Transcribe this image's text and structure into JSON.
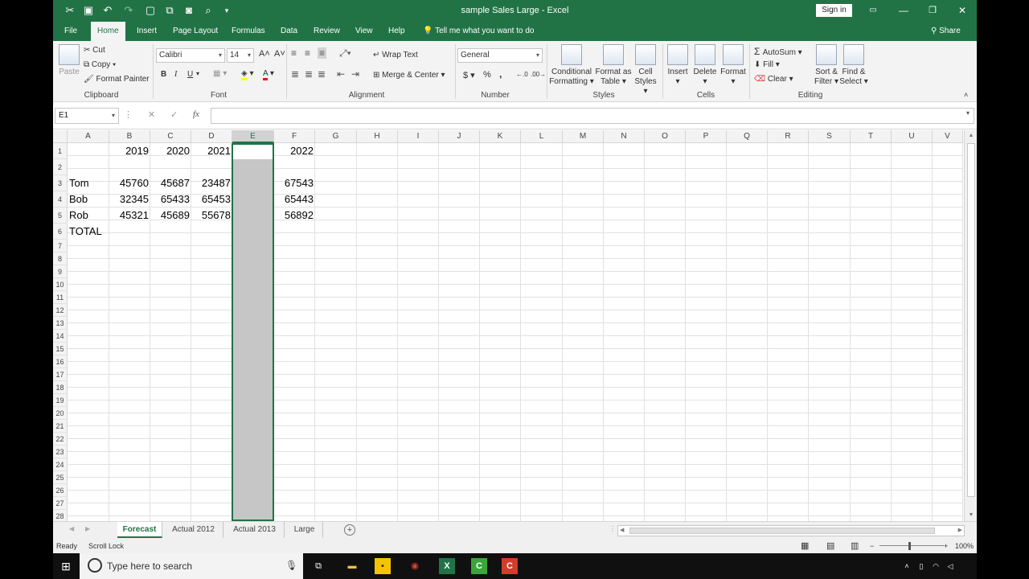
{
  "window": {
    "title": "sample Sales Large  -  Excel",
    "sign_in": "Sign in"
  },
  "tabs": [
    "File",
    "Home",
    "Insert",
    "Page Layout",
    "Formulas",
    "Data",
    "Review",
    "View",
    "Help"
  ],
  "active_tab": "Home",
  "tell_me": "Tell me what you want to do",
  "share": "Share",
  "ribbon": {
    "clipboard": {
      "paste": "Paste",
      "cut": "Cut",
      "copy": "Copy",
      "format_painter": "Format Painter",
      "label": "Clipboard"
    },
    "font": {
      "name": "Calibri",
      "size": "14",
      "bold": "B",
      "italic": "I",
      "underline": "U",
      "label": "Font"
    },
    "alignment": {
      "wrap": "Wrap Text",
      "merge": "Merge & Center",
      "label": "Alignment"
    },
    "number": {
      "format": "General",
      "currency": "$",
      "percent": "%",
      "comma": ",",
      "label": "Number"
    },
    "styles": {
      "conditional": [
        "Conditional",
        "Formatting"
      ],
      "format_table": [
        "Format as",
        "Table"
      ],
      "cell_styles": [
        "Cell",
        "Styles"
      ],
      "label": "Styles"
    },
    "cells": {
      "insert": "Insert",
      "delete": "Delete",
      "format": "Format",
      "label": "Cells"
    },
    "editing": {
      "autosum": "AutoSum",
      "fill": "Fill",
      "clear": "Clear",
      "sort": [
        "Sort &",
        "Filter"
      ],
      "find": [
        "Find &",
        "Select"
      ],
      "label": "Editing"
    }
  },
  "name_box": "E1",
  "formula_bar": {
    "fx": "fx",
    "cancel": "✕",
    "enter": "✓"
  },
  "columns": [
    "A",
    "B",
    "C",
    "D",
    "E",
    "F",
    "G",
    "H",
    "I",
    "J",
    "K",
    "L",
    "M",
    "N",
    "O",
    "P",
    "Q",
    "R",
    "S",
    "T",
    "U",
    "V"
  ],
  "rows": [
    "1",
    "2",
    "3",
    "4",
    "5",
    "6",
    "7",
    "8",
    "9",
    "10",
    "11",
    "12",
    "13",
    "14",
    "15",
    "16",
    "17",
    "18",
    "19",
    "20",
    "21",
    "22",
    "23",
    "24",
    "25",
    "26",
    "27",
    "28"
  ],
  "cells": {
    "B1": "2019",
    "C1": "2020",
    "D1": "2021",
    "F1": "2022",
    "A3": "Tom",
    "B3": "45760",
    "C3": "45687",
    "D3": "23487",
    "F3": "67543",
    "A4": "Bob",
    "B4": "32345",
    "C4": "65433",
    "D4": "65453",
    "F4": "65443",
    "A5": "Rob",
    "B5": "45321",
    "C5": "45689",
    "D5": "55678",
    "F5": "56892",
    "A6": "TOTAL"
  },
  "sheets": [
    "Forecast",
    "Actual 2012",
    "Actual 2013",
    "Large"
  ],
  "active_sheet": "Forecast",
  "status": {
    "ready": "Ready",
    "scroll_lock": "Scroll Lock",
    "zoom": "100%"
  },
  "taskbar": {
    "search_placeholder": "Type here to search"
  },
  "colors": {
    "excel_green": "#217346",
    "selection_gray": "#c6c6c6"
  }
}
